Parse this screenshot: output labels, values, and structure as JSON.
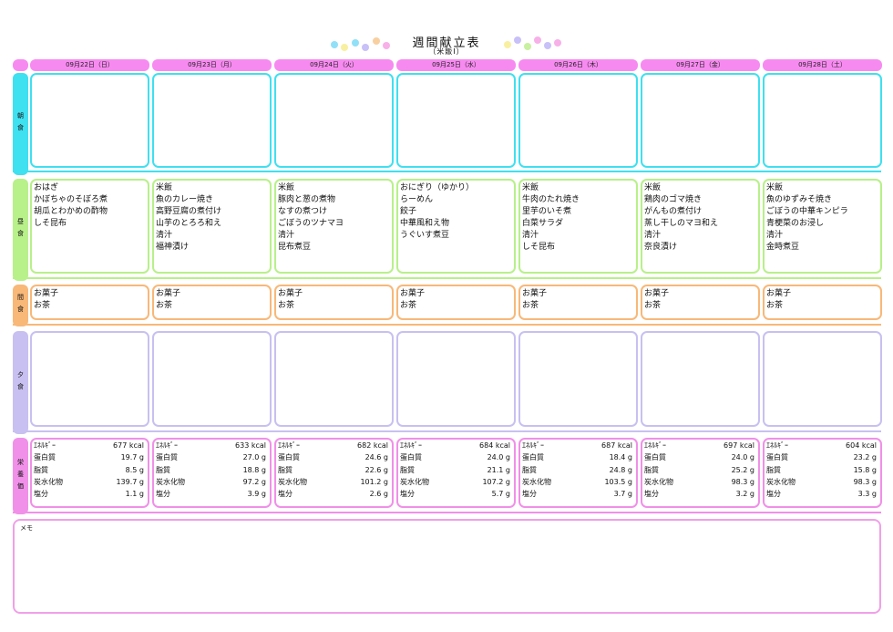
{
  "title": "週間献立表",
  "subtitle": "（米飯Ⅰ）",
  "colors": {
    "header": "#f78af0",
    "breakfast": "#3fe0f0",
    "lunch": "#b8f08a",
    "snack": "#f8b878",
    "dinner": "#c8c0f0",
    "nutrition": "#f090e8",
    "memo": "#f0a0e8"
  },
  "meals": {
    "breakfast": "朝食",
    "lunch": "昼食",
    "snack": "間食",
    "dinner": "夕食",
    "nutrition": "栄養価"
  },
  "nutrient_labels": [
    "ｴﾈﾙｷﾞｰ",
    "蛋白質",
    "脂質",
    "炭水化物",
    "塩分"
  ],
  "days": [
    {
      "date": "09月22日（日）",
      "lunch": [
        "おはぎ",
        "かぼちゃのそぼろ煮",
        "胡瓜とわかめの酢物",
        "しそ昆布"
      ],
      "snack": [
        "お菓子",
        "お茶"
      ],
      "nutrition": [
        "677 kcal",
        "19.7 g",
        "8.5 g",
        "139.7 g",
        "1.1 g"
      ]
    },
    {
      "date": "09月23日（月）",
      "lunch": [
        "米飯",
        "魚のカレー焼き",
        "高野豆腐の煮付け",
        "山芋のとろろ和え",
        "清汁",
        "福神漬け"
      ],
      "snack": [
        "お菓子",
        "お茶"
      ],
      "nutrition": [
        "633 kcal",
        "27.0 g",
        "18.8 g",
        "97.2 g",
        "3.9 g"
      ]
    },
    {
      "date": "09月24日（火）",
      "lunch": [
        "米飯",
        "豚肉と葱の煮物",
        "なすの煮つけ",
        "ごぼうのツナマヨ",
        "清汁",
        "昆布煮豆"
      ],
      "snack": [
        "お菓子",
        "お茶"
      ],
      "nutrition": [
        "682 kcal",
        "24.6 g",
        "22.6 g",
        "101.2 g",
        "2.6 g"
      ]
    },
    {
      "date": "09月25日（水）",
      "lunch": [
        "おにぎり（ゆかり）",
        "らーめん",
        "餃子",
        "中華風和え物",
        "うぐいす煮豆"
      ],
      "snack": [
        "お菓子",
        "お茶"
      ],
      "nutrition": [
        "684 kcal",
        "24.0 g",
        "21.1 g",
        "107.2 g",
        "5.7 g"
      ]
    },
    {
      "date": "09月26日（木）",
      "lunch": [
        "米飯",
        "牛肉のたれ焼き",
        "里芋のいそ煮",
        "白菜サラダ",
        "清汁",
        "しそ昆布"
      ],
      "snack": [
        "お菓子",
        "お茶"
      ],
      "nutrition": [
        "687 kcal",
        "18.4 g",
        "24.8 g",
        "103.5 g",
        "3.7 g"
      ]
    },
    {
      "date": "09月27日（金）",
      "lunch": [
        "米飯",
        "鶏肉のゴマ焼き",
        "がんもの煮付け",
        "蒸し干しのマヨ和え",
        "清汁",
        "奈良漬け"
      ],
      "snack": [
        "お菓子",
        "お茶"
      ],
      "nutrition": [
        "697 kcal",
        "24.0 g",
        "25.2 g",
        "98.3 g",
        "3.2 g"
      ]
    },
    {
      "date": "09月28日（土）",
      "lunch": [
        "米飯",
        "魚のゆずみそ焼き",
        "ごぼうの中華キンピラ",
        "青梗菜のお浸し",
        "清汁",
        "金時煮豆"
      ],
      "snack": [
        "お菓子",
        "お茶"
      ],
      "nutrition": [
        "604 kcal",
        "23.2 g",
        "15.8 g",
        "98.3 g",
        "3.3 g"
      ]
    }
  ],
  "memo_label": "メモ"
}
